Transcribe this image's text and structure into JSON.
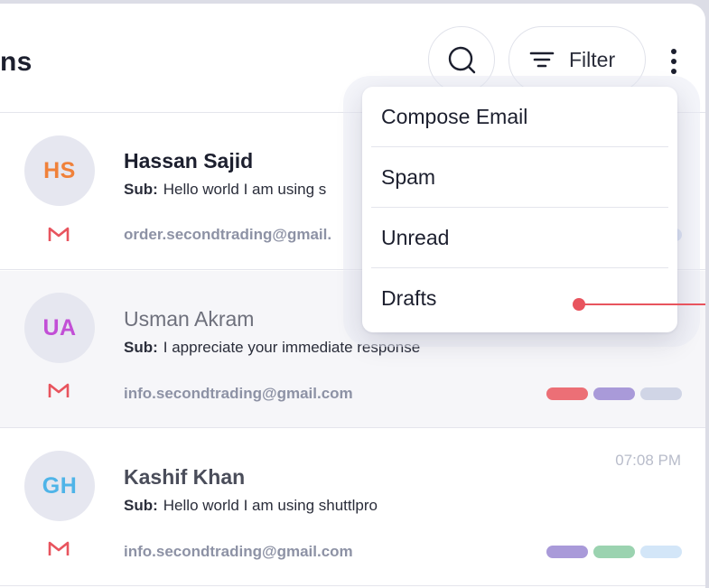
{
  "header": {
    "title": "ns",
    "filter_label": "Filter"
  },
  "icons": {
    "search": "search-icon",
    "filter": "filter-lines-icon",
    "more": "kebab-menu-icon",
    "gmail": "gmail-icon"
  },
  "emails": [
    {
      "initials": "HS",
      "initials_color": "#f0813a",
      "name": "Hassan Sajid",
      "subject_label": "Sub:",
      "subject": "Hello world I am using s",
      "email": "order.secondtrading@gmail.",
      "time": "",
      "tags": [
        "#c8d4f2"
      ]
    },
    {
      "initials": "UA",
      "initials_color": "#c24fd6",
      "name": "Usman Akram",
      "subject_label": "Sub:",
      "subject": "I appreciate your immediate response",
      "email": "info.secondtrading@gmail.com",
      "time": "",
      "tags": [
        "#ec6f76",
        "#a99ad9",
        "#d0d5e6"
      ]
    },
    {
      "initials": "GH",
      "initials_color": "#4fb4e8",
      "name": "Kashif Khan",
      "subject_label": "Sub:",
      "subject": "Hello world I am using shuttlpro",
      "email": "info.secondtrading@gmail.com",
      "time": "07:08 PM",
      "tags": [
        "#a99ad9",
        "#9bd3b0",
        "#d3e6f8"
      ]
    }
  ],
  "menu": {
    "items": [
      "Compose Email",
      "Spam",
      "Unread",
      "Drafts"
    ]
  },
  "colors": {
    "gmail_red": "#e8545e",
    "pointer": "#e8545e"
  }
}
